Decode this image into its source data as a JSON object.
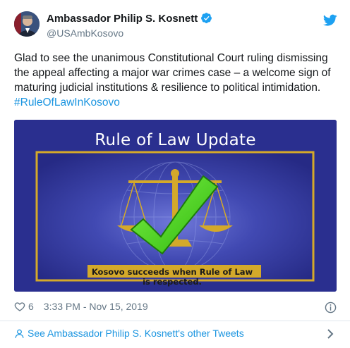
{
  "author": {
    "name": "Ambassador Philip S. Kosnett",
    "handle": "@USAmbKosovo"
  },
  "tweet": {
    "text": "Glad to see the unanimous Constitutional Court ruling dismissing the appeal affecting a major war crimes case – a welcome sign of maturing judicial institutions & resilience to political intimidation. ",
    "hashtag": "#RuleOfLawInKosovo"
  },
  "media": {
    "title": "Rule of Law Update",
    "caption": "Kosovo succeeds when Rule of Law is respected."
  },
  "meta": {
    "likes": "6",
    "timestamp": "3:33 PM - Nov 15, 2019"
  },
  "footer": {
    "link_text": "See Ambassador Philip S. Kosnett's other Tweets"
  },
  "icons": {
    "verified": "verified-badge-icon",
    "brand": "twitter-bird-icon",
    "like": "heart-icon",
    "info": "info-icon",
    "person": "person-icon",
    "chevron": "chevron-right-icon"
  },
  "colors": {
    "link": "#1b95e0",
    "secondary_text": "#657786",
    "media_background": "#2a2f8f",
    "frame_gold": "#d4a92a",
    "check_green": "#4cd11f"
  }
}
